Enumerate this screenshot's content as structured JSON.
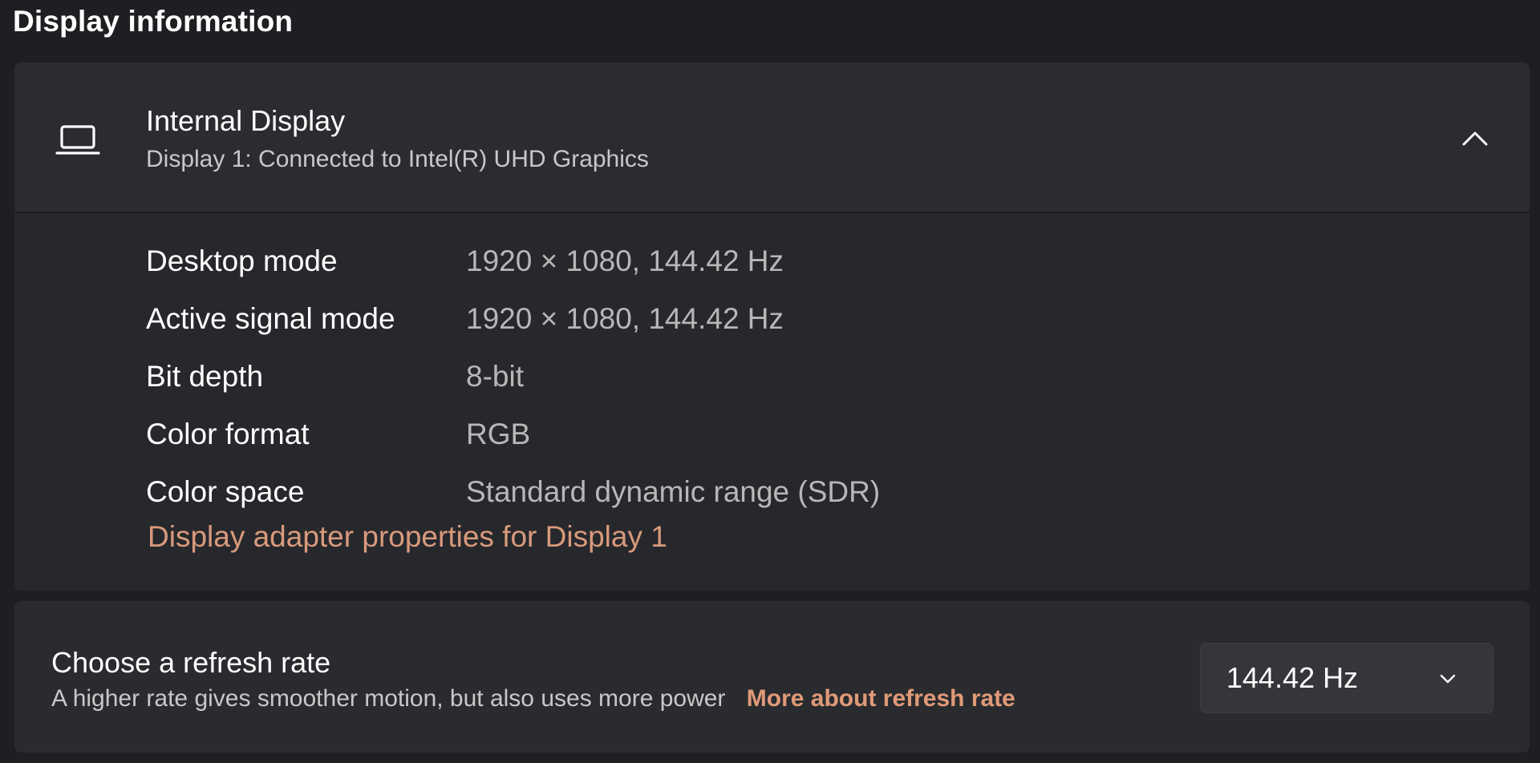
{
  "section": {
    "title": "Display information"
  },
  "display": {
    "icon": "laptop-icon",
    "name": "Internal Display",
    "subtitle": "Display 1: Connected to Intel(R) UHD Graphics",
    "expanded": true,
    "properties": [
      {
        "label": "Desktop mode",
        "value": "1920 × 1080, 144.42 Hz"
      },
      {
        "label": "Active signal mode",
        "value": "1920 × 1080, 144.42 Hz"
      },
      {
        "label": "Bit depth",
        "value": "8-bit"
      },
      {
        "label": "Color format",
        "value": "RGB"
      },
      {
        "label": "Color space",
        "value": "Standard dynamic range (SDR)"
      }
    ],
    "adapter_link": "Display adapter properties for Display 1"
  },
  "refresh": {
    "title": "Choose a refresh rate",
    "description": "A higher rate gives smoother motion, but also uses more power",
    "link": "More about refresh rate",
    "selected": "144.42 Hz"
  },
  "colors": {
    "background": "#1e1f22",
    "card": "#2a2b2f",
    "accent_link": "#d99a7c",
    "secondary_text": "#b7b7b7"
  }
}
